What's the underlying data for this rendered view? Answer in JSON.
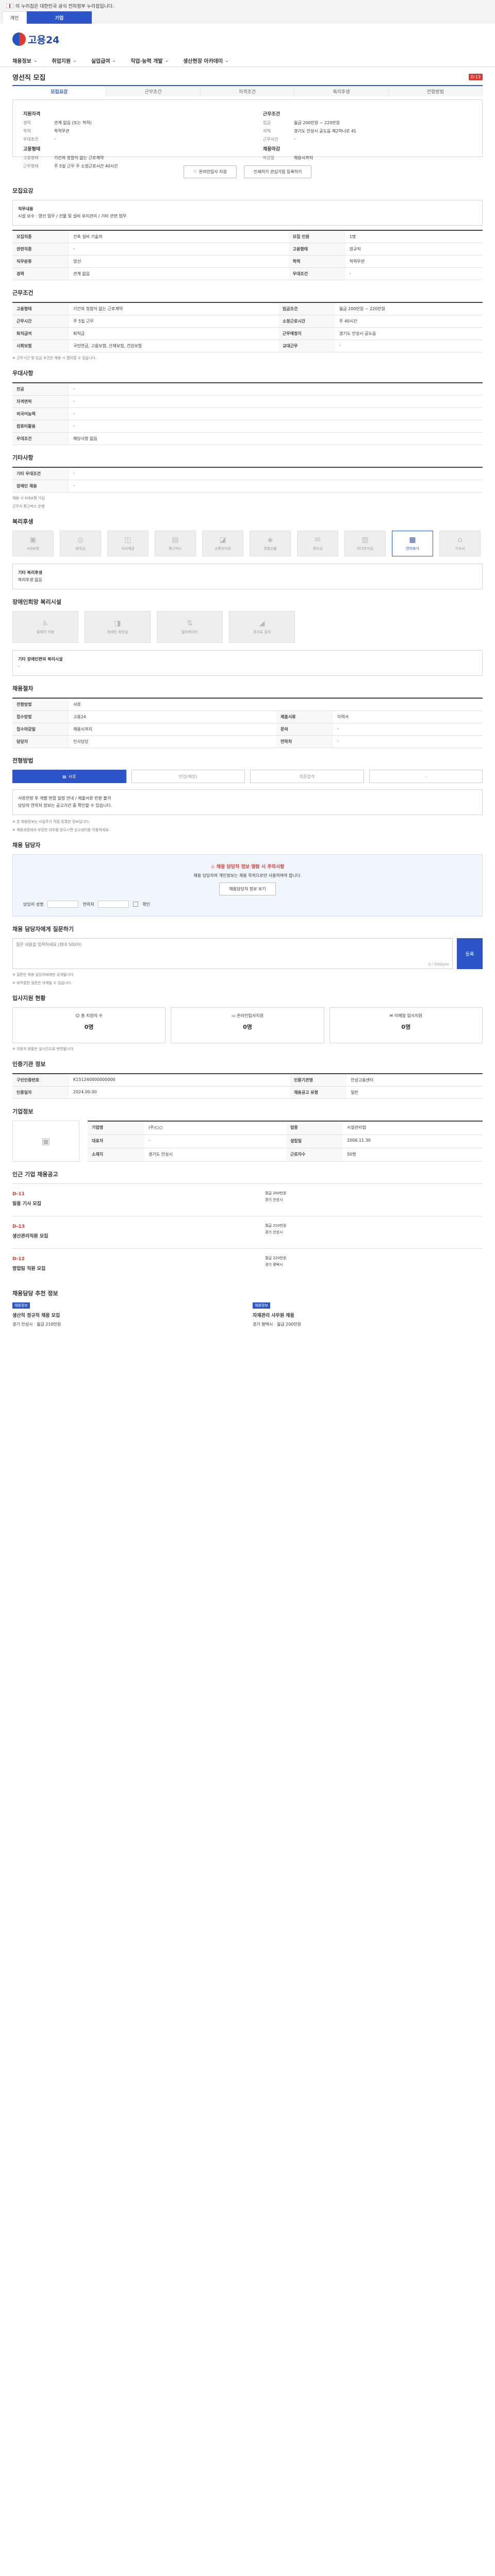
{
  "gov": {
    "text": "이 누리집은 대한민국 공식 전자정부 누리집입니다."
  },
  "topnav": {
    "tabs": [
      "개인",
      "기업"
    ],
    "work": "고용24"
  },
  "logo": {
    "text": "고용24"
  },
  "mainnav": [
    "채용정보",
    "취업지원",
    "실업급여",
    "직업·능력 개발",
    "생산현장 아카데미"
  ],
  "title": "영선직 모집",
  "title_badge": "D-13",
  "tabs": [
    "모집요강",
    "근무조건",
    "자격조건",
    "복리후생",
    "전형방법"
  ],
  "summary": {
    "left": {
      "head": "지원자격",
      "rows": [
        [
          "경력",
          "관계 없음 (또는 학력)"
        ],
        [
          "학력",
          "학력무관"
        ],
        [
          "우대조건",
          "-"
        ]
      ],
      "head2": "고용형태",
      "rows2": [
        [
          "고용형태",
          "기간의 정함이 없는 근로계약"
        ],
        [
          "근무형태",
          "주 5일 근무 주 소정근로시간 40시간"
        ]
      ]
    },
    "right": {
      "head": "근무조건",
      "rows": [
        [
          "임금",
          "월급 200만원 ~ 220만원"
        ],
        [
          "지역",
          "경기도 안성시 공도읍 제2하나로 41"
        ],
        [
          "근무시간",
          "-"
        ]
      ],
      "head2": "채용마감",
      "rows2": [
        [
          "마감일",
          "채용시까지"
        ]
      ]
    }
  },
  "btns": {
    "apply": "온라인입사 지원",
    "like": "인쇄하기 관심기업 등록하기"
  },
  "sec1": {
    "title": "모집요강",
    "subt": "직무내용",
    "content": "시설 보수 · 영선 업무 / 건물 및 설비 유지관리 / 기타 관련 업무",
    "rows": [
      [
        "모집직종",
        "건축 설비 기술자",
        "모집 인원",
        "1명"
      ],
      [
        "관련직종",
        "-",
        "고용형태",
        "정규직"
      ],
      [
        "직무분류",
        "영선",
        "학력",
        "학력무관"
      ],
      [
        "경력",
        "관계 없음",
        "우대조건",
        "-"
      ]
    ]
  },
  "sec2": {
    "title": "근무조건",
    "rows": [
      [
        "고용형태",
        "기간의 정함이 없는 근로계약",
        "임금조건",
        "월급 200만원 ~ 220만원"
      ],
      [
        "근무시간",
        "주 5일 근무",
        "소정근로시간",
        "주 40시간"
      ],
      [
        "퇴직급여",
        "퇴직금",
        "근무예정지",
        "경기도 안성시 공도읍"
      ],
      [
        "사회보험",
        "국민연금, 고용보험, 산재보험, 건강보험",
        "교대근무",
        "-"
      ]
    ],
    "note": "※ 근무시간 및 임금 조건은 채용 시 협의할 수 있습니다."
  },
  "sec3": {
    "title": "우대사항",
    "rows": [
      [
        "전공",
        "-"
      ],
      [
        "자격면허",
        "-"
      ],
      [
        "외국어능력",
        "-"
      ],
      [
        "컴퓨터활용",
        "-"
      ],
      [
        "우대조건",
        "해당사항 없음"
      ]
    ]
  },
  "sec4": {
    "title": "기타사항",
    "rows": [
      [
        "기타 우대조건",
        "-"
      ],
      [
        "장애인 채용",
        "-"
      ]
    ],
    "list": [
      "채용 시 4대보험 가입",
      "근무지 통근버스 운행"
    ]
  },
  "sec5": {
    "title": "복리후생",
    "icons": [
      "4대보험",
      "퇴직금",
      "식사제공",
      "통근버스",
      "교통비지원",
      "명절선물",
      "경조금",
      "자녀학자금",
      "연차휴가",
      "기숙사"
    ],
    "on": 8,
    "box_head": "기타 복리후생",
    "box_text": "복리후생 없음"
  },
  "sec6": {
    "title": "장애인희망 복리시설",
    "icons": [
      "휠체어 이용",
      "장애인 화장실",
      "엘리베이터",
      "경사로 설치"
    ],
    "box_head": "기타 장애인편의 복리시설",
    "box_text": "-"
  },
  "sec7": {
    "title": "채용절차",
    "rows": [
      [
        "전형방법",
        "서류"
      ],
      [
        "접수방법",
        "고용24",
        "제출서류",
        "이력서"
      ],
      [
        "접수마감일",
        "채용시까지",
        "문의",
        "-"
      ],
      [
        "담당자",
        "인사담당",
        "연락처",
        "-"
      ]
    ]
  },
  "sec8": {
    "title": "전형방법",
    "steps": [
      "서류",
      "면접(예정)",
      "최종합격",
      "-"
    ],
    "box": "서류전형 후 개별 면접 일정 안내 / 제출서류 반환 불가",
    "contact": "담당자 연락처 정보는 공고기간 중 확인할 수 있습니다.",
    "note1": "※ 본 채용정보는 사업주가 직접 등록한 정보입니다.",
    "note2": "※ 채용과정에서 부당한 대우를 받으시면 신고센터를 이용하세요."
  },
  "sec9": {
    "title": "채용 담당자",
    "warn": "채용 담당자 정보 열람 시 주의사항",
    "warn_text": "채용 담당자의 개인정보는 채용 목적으로만 사용하여야 합니다.",
    "btn": "채용담당자 정보 보기",
    "name": "담당자 성명",
    "phone": "연락처",
    "agree": "확인"
  },
  "sec10": {
    "title": "채용 담당자에게 질문하기",
    "placeholder": "질문 내용을 입력하세요 (최대 500자)",
    "counter": "0 / 500byte",
    "submit": "등록",
    "notes": [
      "※ 질문은 채용 담당자에게만 공개됩니다.",
      "※ 부적절한 질문은 삭제될 수 있습니다."
    ]
  },
  "sec11": {
    "title": "입사지원 현황",
    "cards": [
      [
        "총 지원자 수",
        "0명"
      ],
      [
        "온라인입사지원",
        "0명"
      ],
      [
        "이메일 입사지원",
        "0명"
      ]
    ],
    "note": "※ 지원자 현황은 실시간으로 반영됩니다."
  },
  "sec12": {
    "title": "인증기관 정보",
    "rows": [
      [
        "구인인증번호",
        "K151240000000000",
        "인증기관명",
        "안성고용센터"
      ],
      [
        "인증일자",
        "2024.00.00",
        "채용공고 유형",
        "일반"
      ]
    ]
  },
  "sec13": {
    "title": "기업정보",
    "rows": [
      [
        "기업명",
        "(주)○○",
        "업종",
        "시설관리업"
      ],
      [
        "대표자",
        "-",
        "설립일",
        "2006.11.30"
      ],
      [
        "소재지",
        "경기도 안성시",
        "근로자수",
        "50명"
      ]
    ]
  },
  "sec14": {
    "title": "인근 기업 채용공고",
    "jobs": [
      {
        "dday": "D-11",
        "title": "일용 기사 모집",
        "pay": "월급 200만원",
        "place": "경기 안성시"
      },
      {
        "dday": "D-13",
        "title": "생산관리직원 모집",
        "pay": "월급 210만원",
        "place": "경기 안성시"
      },
      {
        "dday": "D-12",
        "title": "영업팀 직원 모집",
        "pay": "월급 220만원",
        "place": "경기 평택시"
      }
    ]
  },
  "sec15": {
    "title": "채용담당 추천 정보",
    "items": [
      {
        "tag": "채용정보",
        "title": "생산직 정규직 채용 모집",
        "body": "경기 안성시 · 월급 210만원"
      },
      {
        "tag": "채용정보",
        "title": "자재관리 사무원 채용",
        "body": "경기 평택시 · 월급 200만원"
      }
    ]
  }
}
